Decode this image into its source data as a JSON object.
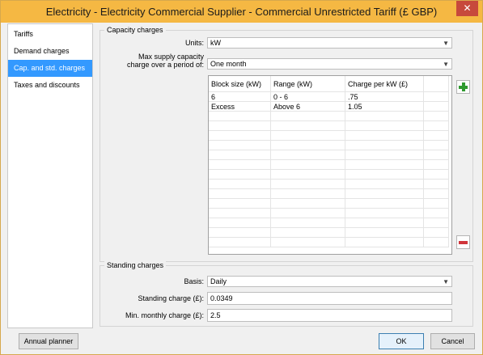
{
  "window": {
    "title": "Electricity - Electricity Commercial Supplier - Commercial Unrestricted Tariff (£ GBP)",
    "close_glyph": "✕"
  },
  "sidebar": {
    "items": [
      {
        "label": "Tariffs"
      },
      {
        "label": "Demand charges"
      },
      {
        "label": "Cap. and std. charges"
      },
      {
        "label": "Taxes and discounts"
      }
    ],
    "selected": "Cap. and std. charges"
  },
  "capacity": {
    "group_title": "Capacity charges",
    "units_label": "Units:",
    "units_value": "kW",
    "period_label_line1": "Max supply capacity",
    "period_label_line2": "charge over a period of:",
    "period_value": "One month",
    "table": {
      "headers": [
        "Block size (kW)",
        "Range (kW)",
        "Charge per kW (£)"
      ],
      "rows": [
        [
          "6",
          "0 - 6",
          ".75"
        ],
        [
          "Excess",
          "Above 6",
          "1.05"
        ]
      ]
    },
    "add_icon": "plus-icon",
    "remove_icon": "minus-icon"
  },
  "standing": {
    "group_title": "Standing charges",
    "basis_label": "Basis:",
    "basis_value": "Daily",
    "charge_label": "Standing charge (£):",
    "charge_value": "0.0349",
    "min_label": "Min. monthly charge (£):",
    "min_value": "2.5"
  },
  "footer": {
    "annual_planner": "Annual planner",
    "ok": "OK",
    "cancel": "Cancel"
  },
  "colors": {
    "titlebar": "#f5b843",
    "selected_item": "#3399ff",
    "close_button": "#c7493c"
  }
}
